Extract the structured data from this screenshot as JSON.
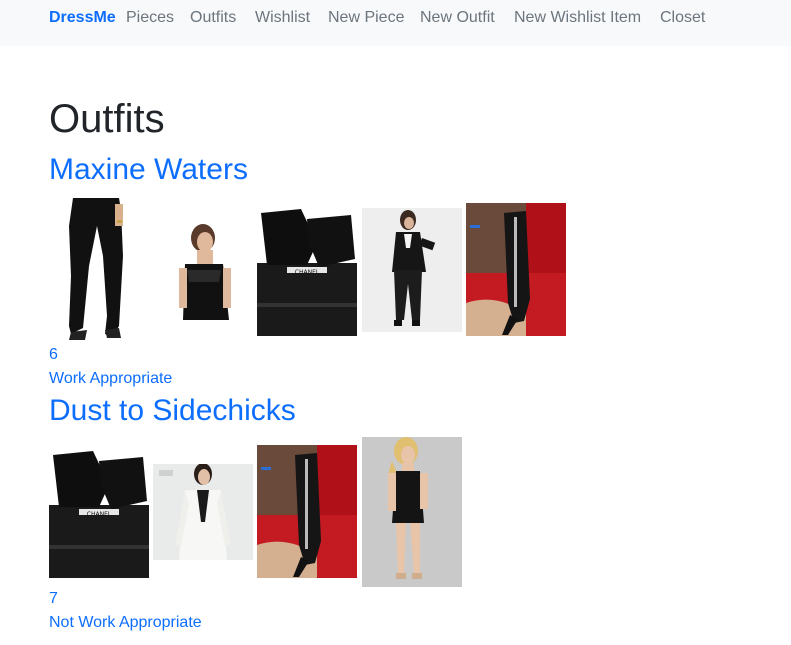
{
  "nav": {
    "brand": "DressMe",
    "links": [
      "Pieces",
      "Outfits",
      "Wishlist",
      "New Piece",
      "New Outfit",
      "New Wishlist Item",
      "Closet"
    ]
  },
  "page": {
    "title": "Outfits"
  },
  "outfits": [
    {
      "name": "Maxine Waters",
      "id": "6",
      "tag": "Work Appropriate",
      "pieces": [
        "black-trousers-image",
        "black-lace-camisole-image",
        "chanel-black-gloves-image",
        "black-suit-outfit-image",
        "zipper-heel-boot-image"
      ]
    },
    {
      "name": "Dust to Sidechicks",
      "id": "7",
      "tag": "Not Work Appropriate",
      "pieces": [
        "chanel-black-gloves-image",
        "white-blazer-image",
        "zipper-heel-boot-image",
        "black-mini-dress-image"
      ]
    }
  ],
  "colors": {
    "accent": "#0d6efd",
    "nav_bg": "#f8f9fa",
    "nav_text": "#6c757d",
    "heading": "#212529"
  }
}
